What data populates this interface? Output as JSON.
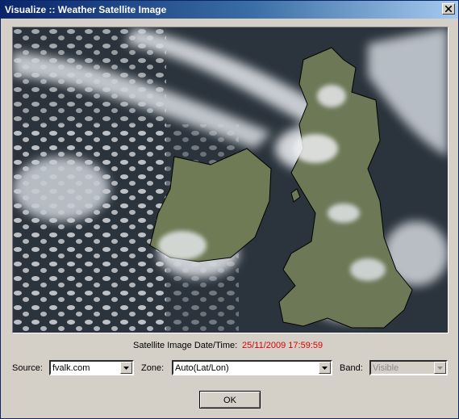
{
  "window": {
    "title": "Visualize :: Weather Satellite Image",
    "close_glyph": "✕"
  },
  "image": {
    "description_icon": "satellite-image"
  },
  "datetime": {
    "label": "Satellite Image Date/Time:",
    "value": "25/11/2009 17:59:59",
    "value_color": "#e00000"
  },
  "controls": {
    "source_label": "Source:",
    "source_value": "fvalk.com",
    "zone_label": "Zone:",
    "zone_value": "Auto(Lat/Lon)",
    "band_label": "Band:",
    "band_value": "Visible"
  },
  "buttons": {
    "ok_label": "OK"
  }
}
